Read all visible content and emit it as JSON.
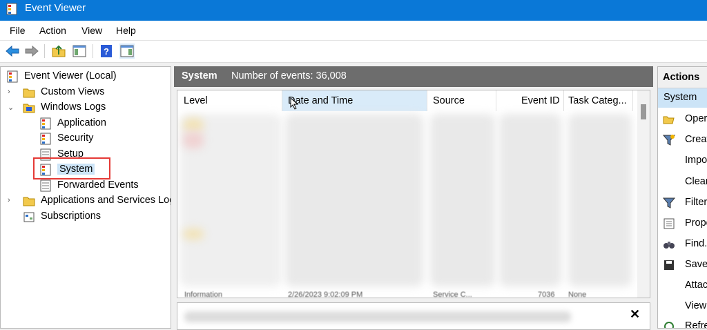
{
  "window": {
    "title": "Event Viewer"
  },
  "menu": [
    "File",
    "Action",
    "View",
    "Help"
  ],
  "tree": {
    "root": "Event Viewer (Local)",
    "custom_views": "Custom Views",
    "windows_logs": "Windows Logs",
    "application": "Application",
    "security": "Security",
    "setup": "Setup",
    "system": "System",
    "forwarded": "Forwarded Events",
    "apps_services": "Applications and Services Log",
    "subscriptions": "Subscriptions"
  },
  "center": {
    "log_name": "System",
    "events_count": "Number of events: 36,008",
    "columns": [
      "Level",
      "Date and Time",
      "Source",
      "Event ID",
      "Task Categ..."
    ],
    "partial_row": [
      "Information",
      "2/26/2023 9:02:09 PM",
      "Service C...",
      "7036",
      "None"
    ]
  },
  "actions": {
    "title": "Actions",
    "section": "System",
    "items": [
      "Oper",
      "Creat",
      "Impo",
      "Clear",
      "Filter",
      "Prope",
      "Find...",
      "Save",
      "Attac",
      "View",
      "Refre"
    ]
  },
  "colors": {
    "titlebar": "#0a78d7",
    "selection": "#cce4f7",
    "header_gray": "#6d6d6d",
    "highlight": "#e53935"
  }
}
